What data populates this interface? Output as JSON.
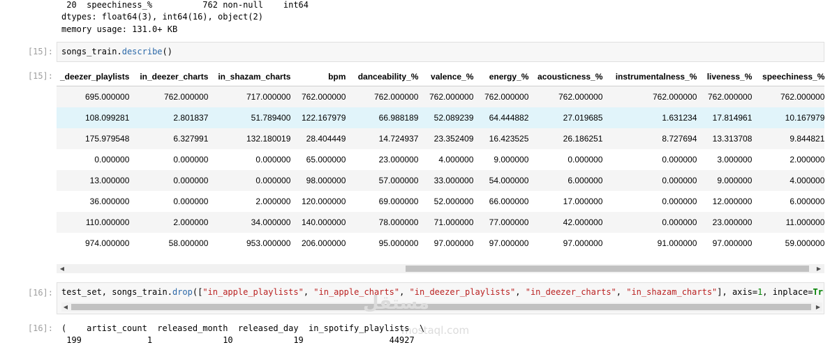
{
  "output_top": {
    "line1": " 20  speechiness_%          762 non-null    int64",
    "line2": "dtypes: float64(3), int64(16), object(2)",
    "line3": "memory usage: 131.0+ KB"
  },
  "cell15": {
    "in_prompt": "[15]:",
    "code_var": "songs_train",
    "code_dot": ".",
    "code_method": "describe",
    "code_parens": "()",
    "out_prompt": "[15]:"
  },
  "df": {
    "columns": [
      "_deezer_playlists",
      "in_deezer_charts",
      "in_shazam_charts",
      "bpm",
      "danceability_%",
      "valence_%",
      "energy_%",
      "acousticness_%",
      "instrumentalness_%",
      "liveness_%",
      "speechiness_%"
    ],
    "rows": [
      [
        "695.000000",
        "762.000000",
        "717.000000",
        "762.000000",
        "762.000000",
        "762.000000",
        "762.000000",
        "762.000000",
        "762.000000",
        "762.000000",
        "762.000000"
      ],
      [
        "108.099281",
        "2.801837",
        "51.789400",
        "122.167979",
        "66.988189",
        "52.089239",
        "64.444882",
        "27.019685",
        "1.631234",
        "17.814961",
        "10.167979"
      ],
      [
        "175.979548",
        "6.327991",
        "132.180019",
        "28.404449",
        "14.724937",
        "23.352409",
        "16.423525",
        "26.186251",
        "8.727694",
        "13.313708",
        "9.844821"
      ],
      [
        "0.000000",
        "0.000000",
        "0.000000",
        "65.000000",
        "23.000000",
        "4.000000",
        "9.000000",
        "0.000000",
        "0.000000",
        "3.000000",
        "2.000000"
      ],
      [
        "13.000000",
        "0.000000",
        "0.000000",
        "98.000000",
        "57.000000",
        "33.000000",
        "54.000000",
        "6.000000",
        "0.000000",
        "9.000000",
        "4.000000"
      ],
      [
        "36.000000",
        "0.000000",
        "2.000000",
        "120.000000",
        "69.000000",
        "52.000000",
        "66.000000",
        "17.000000",
        "0.000000",
        "12.000000",
        "6.000000"
      ],
      [
        "110.000000",
        "2.000000",
        "34.000000",
        "140.000000",
        "78.000000",
        "71.000000",
        "77.000000",
        "42.000000",
        "0.000000",
        "23.000000",
        "11.000000"
      ],
      [
        "974.000000",
        "58.000000",
        "953.000000",
        "206.000000",
        "95.000000",
        "97.000000",
        "97.000000",
        "97.000000",
        "91.000000",
        "97.000000",
        "59.000000"
      ]
    ]
  },
  "cell16": {
    "in_prompt": "[16]:",
    "t1": "test_set, songs_train",
    "t2": ".",
    "t3": "drop",
    "t4": "([",
    "s1": "\"in_apple_playlists\"",
    "c1": ", ",
    "s2": "\"in_apple_charts\"",
    "c2": ", ",
    "s3": "\"in_deezer_playlists\"",
    "c3": ", ",
    "s4": "\"in_deezer_charts\"",
    "c4": ", ",
    "s5": "\"in_shazam_charts\"",
    "t5": "], axis=",
    "n1": "1",
    "t6": ", inplace=",
    "k1": "True",
    "out_prompt": "[16]:",
    "out_line1": "(    artist_count  released_month  released_day  in_spotify_playlists  \\",
    "out_line2": " 199             1              10            19                 44927"
  },
  "scroll": {
    "left_arrow": "◀",
    "right_arrow": "▶"
  },
  "watermark": {
    "text": "مستقل",
    "sub": "mostaql.com"
  }
}
